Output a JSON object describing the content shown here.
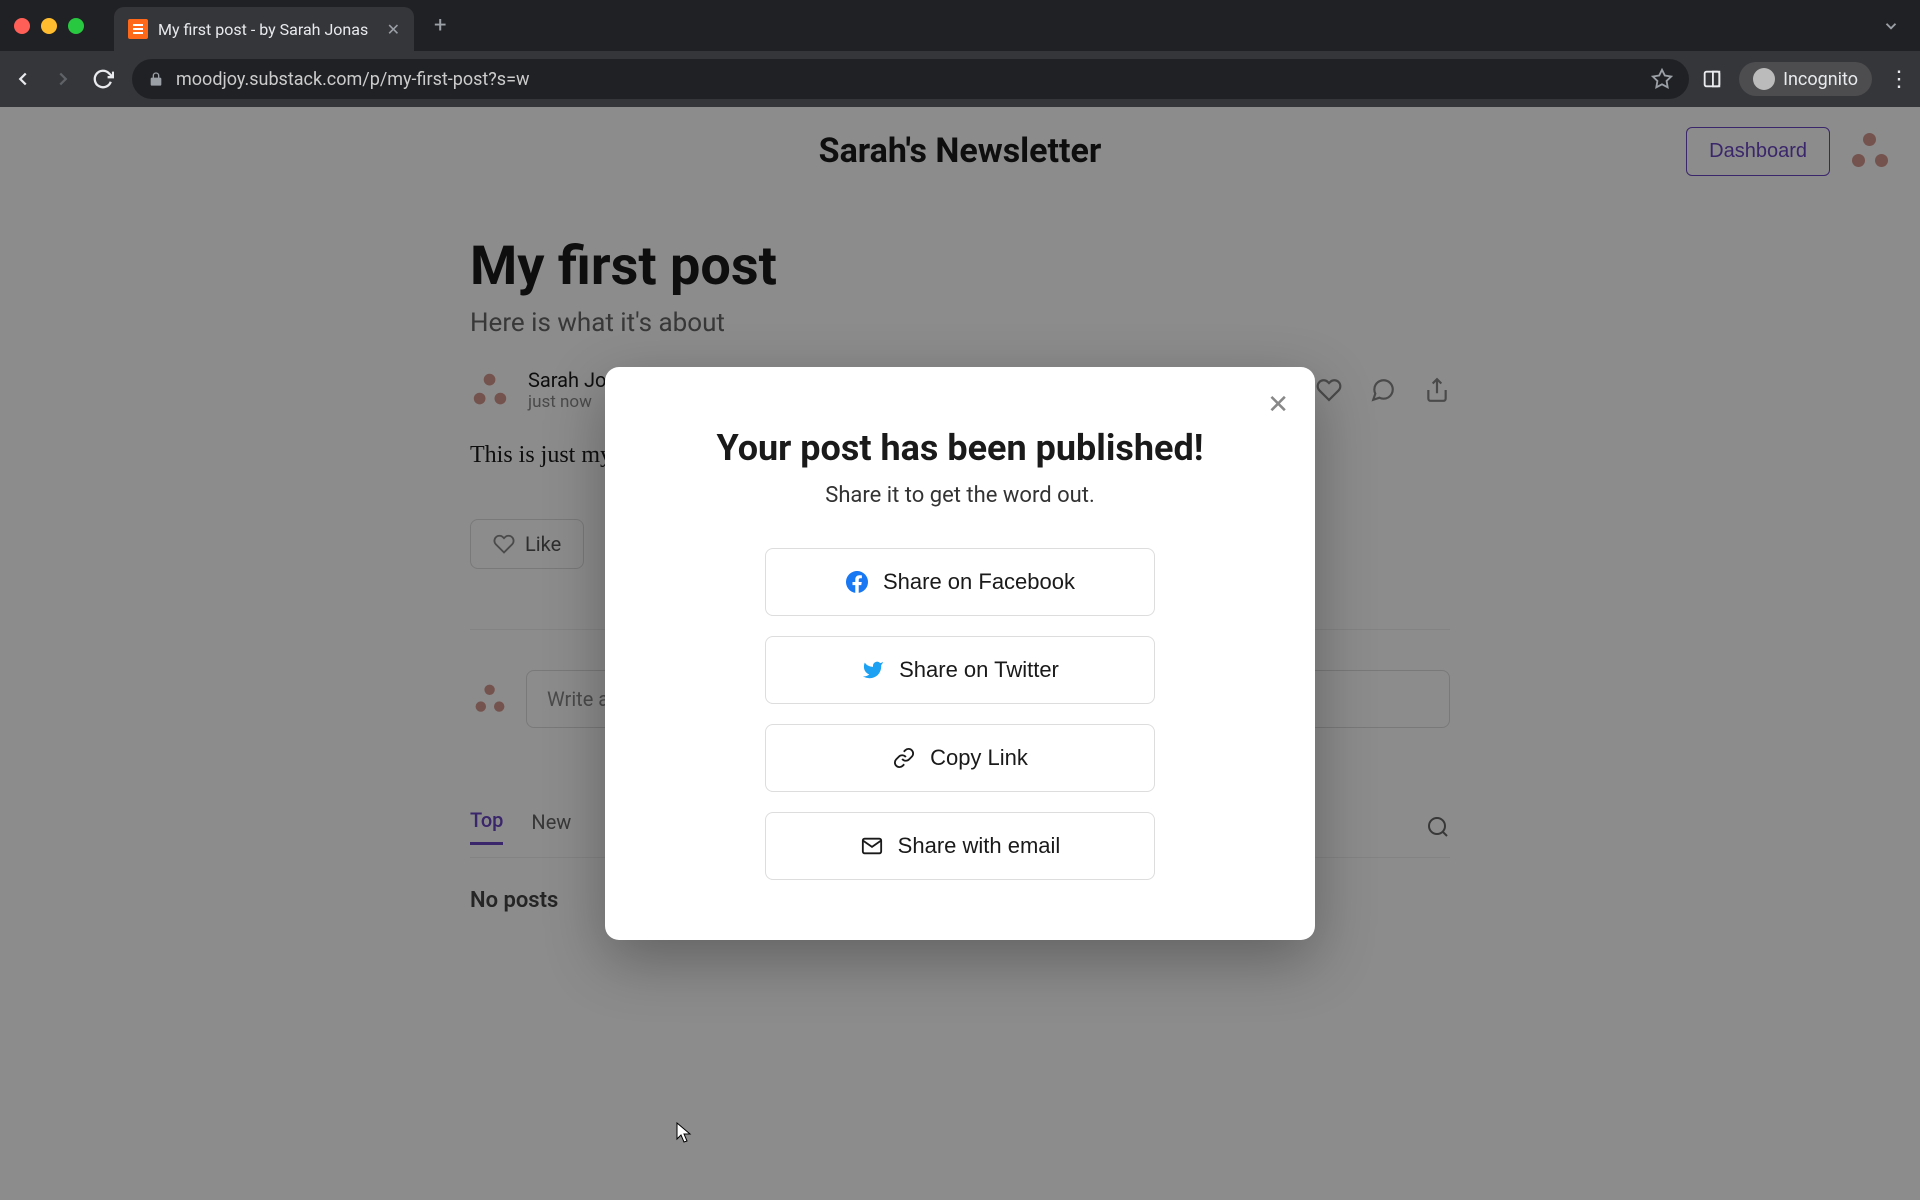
{
  "browser": {
    "tab_title": "My first post - by Sarah Jonas",
    "url": "moodjoy.substack.com/p/my-first-post?s=w",
    "incognito_label": "Incognito"
  },
  "header": {
    "site_title": "Sarah's Newsletter",
    "dashboard_label": "Dashboard"
  },
  "post": {
    "title": "My first post",
    "subtitle": "Here is what it's about",
    "author": "Sarah Jonas",
    "time": "just now",
    "body": "This is just my first post!",
    "like_label": "Like"
  },
  "comments": {
    "placeholder": "Write a comment…"
  },
  "tabs": {
    "top": "Top",
    "new": "New",
    "empty": "No posts"
  },
  "modal": {
    "title": "Your post has been published!",
    "subtitle": "Share it to get the word out.",
    "facebook": "Share on Facebook",
    "twitter": "Share on Twitter",
    "copy": "Copy Link",
    "email": "Share with email"
  }
}
